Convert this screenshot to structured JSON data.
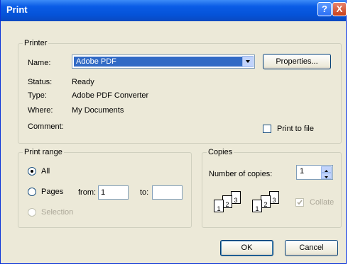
{
  "window": {
    "title": "Print",
    "help_label": "?",
    "close_label": "X"
  },
  "printer": {
    "legend": "Printer",
    "name_label": "Name:",
    "name_value": "Adobe PDF",
    "properties_label": "Properties...",
    "status_label": "Status:",
    "status_value": "Ready",
    "type_label": "Type:",
    "type_value": "Adobe PDF Converter",
    "where_label": "Where:",
    "where_value": "My Documents",
    "comment_label": "Comment:",
    "print_to_file_label": "Print to file"
  },
  "range": {
    "legend": "Print range",
    "all_label": "All",
    "pages_label": "Pages",
    "from_label": "from:",
    "from_value": "1",
    "to_label": "to:",
    "to_value": "",
    "selection_label": "Selection"
  },
  "copies": {
    "legend": "Copies",
    "number_label": "Number of copies:",
    "number_value": "1",
    "collate_label": "Collate",
    "page_numbers": [
      "1",
      "2",
      "3"
    ]
  },
  "buttons": {
    "ok": "OK",
    "cancel": "Cancel"
  },
  "colors": {
    "title_bar": "#0553d8",
    "dialog_bg": "#ece9d8",
    "selection": "#316ac5"
  }
}
